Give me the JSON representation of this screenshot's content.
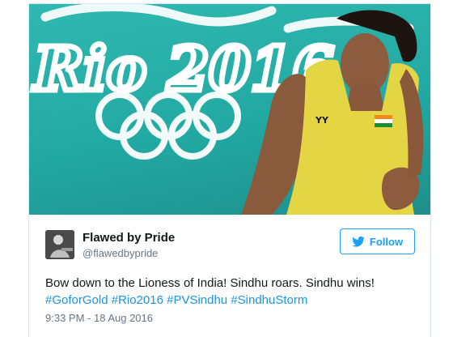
{
  "tweet": {
    "author_name": "Flawed by Pride",
    "author_handle": "@flawedbypride",
    "follow_label": "Follow",
    "text": "Bow down to the Lioness of India! Sindhu roars. Sindhu wins!",
    "hashtags": "#GoforGold #Rio2016 #PVSindhu #SindhuStorm",
    "timestamp": "9:33 PM - 18 Aug 2016"
  },
  "media": {
    "background_text": "Rio 2016"
  },
  "colors": {
    "accent": "#1da1f2",
    "link": "#1b95e0",
    "court": "#2aaea7",
    "jersey": "#e9d94b"
  },
  "icons": {
    "follow": "twitter-bird-icon"
  }
}
